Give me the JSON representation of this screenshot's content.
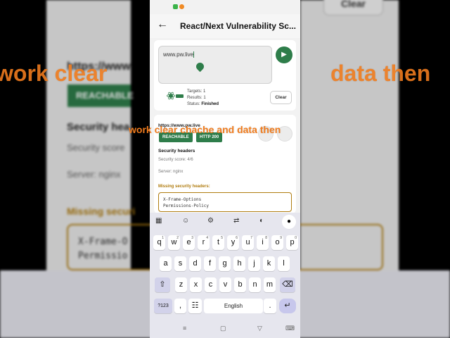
{
  "app": {
    "title": "React/Next Vulnerability Sc...",
    "back_icon": "arrow-left-icon"
  },
  "scan": {
    "url_value": "www.pw.live",
    "run_icon": "play-icon",
    "targets": "Targets: 1",
    "results": "Results: 1",
    "status_label": "Status:",
    "status_value": "Finished",
    "clear_label": "Clear"
  },
  "result": {
    "url": "https://www.pw.live",
    "badges": [
      "REACHABLE",
      "HTTP 200"
    ],
    "security_title": "Security headers",
    "security_score": "Security score: 4/6",
    "server": "Server: nginx",
    "missing_title": "Missing security headers:",
    "missing": [
      "X-Frame-Options",
      "Permissions-Policy"
    ]
  },
  "keyboard": {
    "row1": [
      [
        "q",
        "1"
      ],
      [
        "w",
        "2"
      ],
      [
        "e",
        "3"
      ],
      [
        "r",
        "4"
      ],
      [
        "t",
        "5"
      ],
      [
        "y",
        "6"
      ],
      [
        "u",
        "7"
      ],
      [
        "i",
        "8"
      ],
      [
        "o",
        "9"
      ],
      [
        "p",
        "0"
      ]
    ],
    "row2": [
      "a",
      "s",
      "d",
      "f",
      "g",
      "h",
      "j",
      "k",
      "l"
    ],
    "row3": [
      "z",
      "x",
      "c",
      "v",
      "b",
      "n",
      "m"
    ],
    "sym_label": "?123",
    "comma_label": ",",
    "space_label": "English",
    "period_label": "."
  },
  "overlay": {
    "caption": "work clear chache and data then",
    "bg_left": "work clear",
    "bg_right": "data then"
  },
  "background": {
    "url": "https://www",
    "badge": "REACHABLE",
    "security": "Security hea",
    "score": "Security score",
    "server": "Server: nginx",
    "missing": "Missing securi",
    "box_line1": "X-Frame-O",
    "box_line2": "Permissio",
    "clear": "Clear"
  },
  "colors": {
    "accent": "#2e7d4a",
    "warning": "#b07c0f",
    "overlay": "#f07c1e"
  }
}
